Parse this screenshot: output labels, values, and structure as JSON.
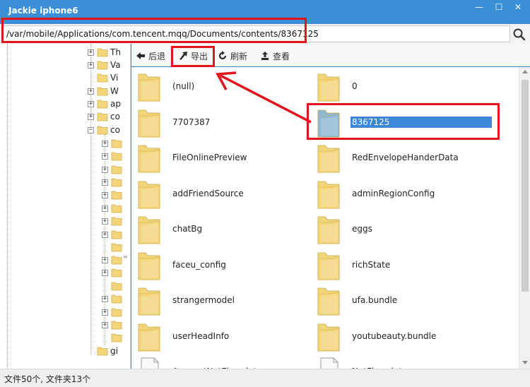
{
  "window": {
    "title": "Jackie iphone6",
    "min_glyph": "—",
    "max_glyph": "☐",
    "close_glyph": "✕"
  },
  "address": {
    "path": "/var/mobile/Applications/com.tencent.mqq/Documents/contents/8367125"
  },
  "toolbar": {
    "back": "后退",
    "export": "导出",
    "refresh": "刷新",
    "view": "查看"
  },
  "tree": {
    "items": [
      {
        "label": "Th"
      },
      {
        "label": "Va"
      },
      {
        "label": "Vi"
      },
      {
        "label": "W"
      },
      {
        "label": "ap"
      },
      {
        "label": "co"
      },
      {
        "label": "co"
      },
      {
        "label": "gi"
      }
    ]
  },
  "files": [
    {
      "name": "(null)"
    },
    {
      "name": "0"
    },
    {
      "name": "7707387"
    },
    {
      "name": "8367125",
      "selected": true
    },
    {
      "name": "FileOnlinePreview"
    },
    {
      "name": "RedEnvelopeHanderData"
    },
    {
      "name": "addFriendSource"
    },
    {
      "name": "adminRegionConfig"
    },
    {
      "name": "chatBg"
    },
    {
      "name": "eggs"
    },
    {
      "name": "faceu_config"
    },
    {
      "name": "richState"
    },
    {
      "name": "strangermodel"
    },
    {
      "name": "ufa.bundle"
    },
    {
      "name": "userHeadInfo"
    },
    {
      "name": "youtubeauty.bundle"
    },
    {
      "name": "AccountNetFlow.data"
    },
    {
      "name": "NetFlow.data"
    }
  ],
  "status": {
    "text": "文件50个, 文件夹13个"
  },
  "colors": {
    "titlebar": "#3a8fd6",
    "selection": "#3d87d9",
    "annotation": "#e3121b",
    "folder": "#f3d57a",
    "folder_selected": "#8fb8d4"
  }
}
